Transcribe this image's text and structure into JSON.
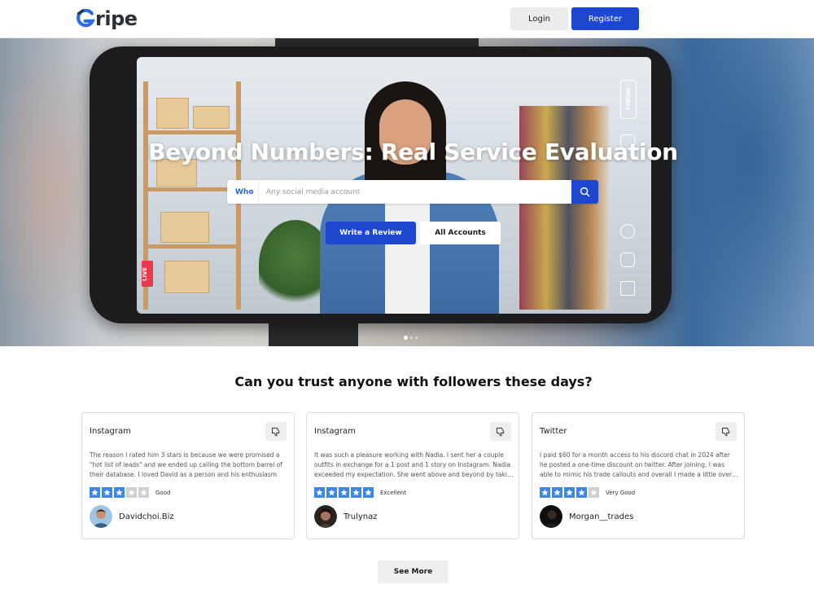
{
  "header": {
    "logo_text": "ripe",
    "login_label": "Login",
    "register_label": "Register"
  },
  "hero": {
    "title": "Beyond Numbers: Real Service Evaluation",
    "search": {
      "who_label": "Who",
      "placeholder": "Any social media account"
    },
    "write_review_label": "Write a Review",
    "all_accounts_label": "All Accounts",
    "phone_overlay": {
      "live_label": "LIVE",
      "finish_label": "FINISH"
    },
    "carousel_active_index": 0
  },
  "section": {
    "title": "Can you trust anyone with followers these days?"
  },
  "reviews": [
    {
      "platform": "Instagram",
      "text": "The reason I rated him 3 stars is because we were promised a \"hot list of leads\" and we ended up calling the bottom barrel of their database. I loved David as a person and his enthusiasm to…",
      "rating": 3,
      "rating_word": "Good",
      "author": "Davidchoi.Biz"
    },
    {
      "platform": "Instagram",
      "text": "It was such a pleasure working with Nadia. I sent her a couple outfits in exchange for a 1 post and 1 story on Instagram. Nadia exceeded my expectation. She went above and beyond by taki…",
      "rating": 5,
      "rating_word": "Excellent",
      "author": "Trulynaz"
    },
    {
      "platform": "Twitter",
      "text": "I paid $60 for a month access to his discord chat in 2024 after he posted a one-time discount on twitter. After joining, I was able to mimic his trade callouts and overall I made a little over…",
      "rating": 4,
      "rating_word": "Very Good",
      "author": "Morgan__trades"
    }
  ],
  "see_more_label": "See More",
  "colors": {
    "primary": "#1e47cf",
    "star": "#3f87e0",
    "star_empty": "#d0d0d0"
  }
}
